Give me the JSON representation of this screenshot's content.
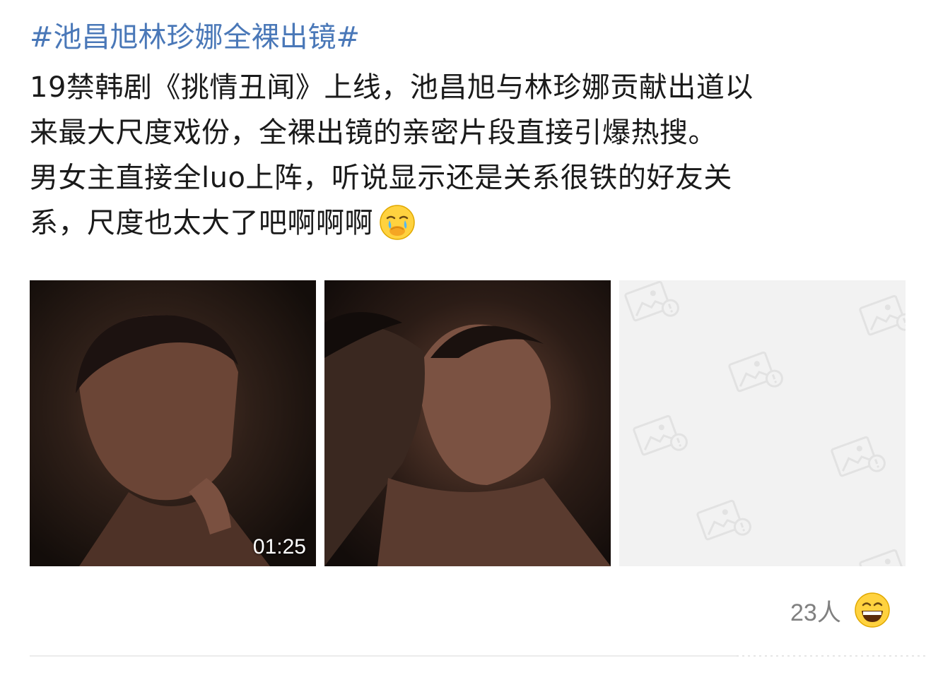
{
  "post": {
    "hashtag": "#池昌旭林珍娜全裸出镜#",
    "lines": [
      "19禁韩剧《挑情丑闻》上线，池昌旭与林珍娜贡献出道以",
      "来最大尺度戏份，全裸出镜的亲密片段直接引爆热搜。",
      "男女主直接全luo上阵，听说显示还是关系很铁的好友关",
      "系，尺度也太大了吧啊啊啊"
    ],
    "inline_emoji": "crying-covering-mouth-emoji"
  },
  "media": {
    "items": [
      {
        "type": "video-thumbnail",
        "duration": "01:25"
      },
      {
        "type": "image-thumbnail"
      },
      {
        "type": "image-placeholder",
        "icon": "broken-image-icon"
      }
    ]
  },
  "reactions": {
    "count_label": "23人",
    "emoji": "grinning-face-emoji"
  },
  "colors": {
    "hashtag": "#4a78b8",
    "text": "#1a1a1a",
    "muted": "#808080",
    "placeholder_bg": "#f2f2f2"
  }
}
